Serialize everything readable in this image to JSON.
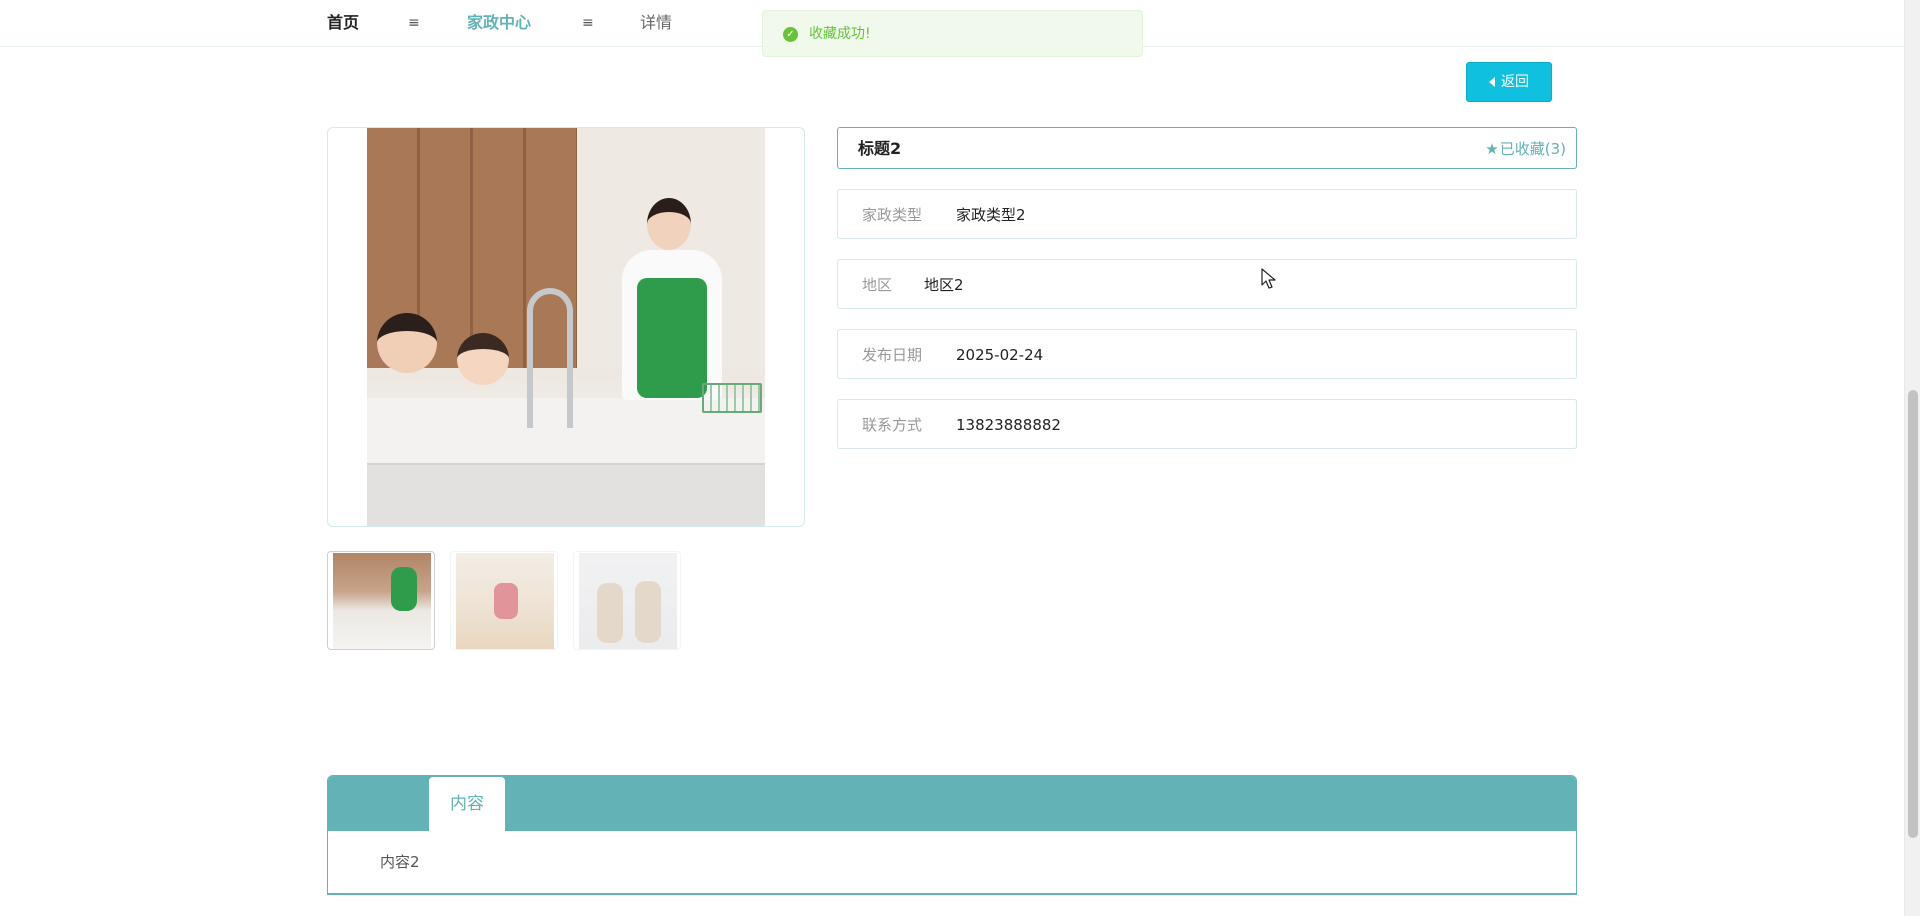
{
  "breadcrumb": {
    "home": "首页",
    "separator": "≡",
    "center": "家政中心",
    "detail": "详情"
  },
  "toast": {
    "icon": "check-circle-icon",
    "message": "收藏成功!"
  },
  "back_button": {
    "icon": "caret-left-icon",
    "label": "返回"
  },
  "gallery": {
    "main_alt": "家政服务图片",
    "thumbnails": [
      {
        "id": "thumb-1",
        "active": true
      },
      {
        "id": "thumb-2",
        "active": false
      },
      {
        "id": "thumb-3",
        "active": false
      }
    ]
  },
  "detail": {
    "title": "标题2",
    "favorite_icon": "star-icon",
    "favorite_label": "已收藏(3)"
  },
  "info": [
    {
      "label": "家政类型",
      "value": "家政类型2"
    },
    {
      "label": "地区",
      "value": "地区2"
    },
    {
      "label": "发布日期",
      "value": "2025-02-24"
    },
    {
      "label": "联系方式",
      "value": "13823888882"
    }
  ],
  "content_tabs": {
    "tab_label": "内容",
    "body": "内容2"
  },
  "colors": {
    "accent": "#63b2b6",
    "button": "#0fc0df",
    "success": "#67c23a",
    "success_bg": "#f0f9eb"
  }
}
